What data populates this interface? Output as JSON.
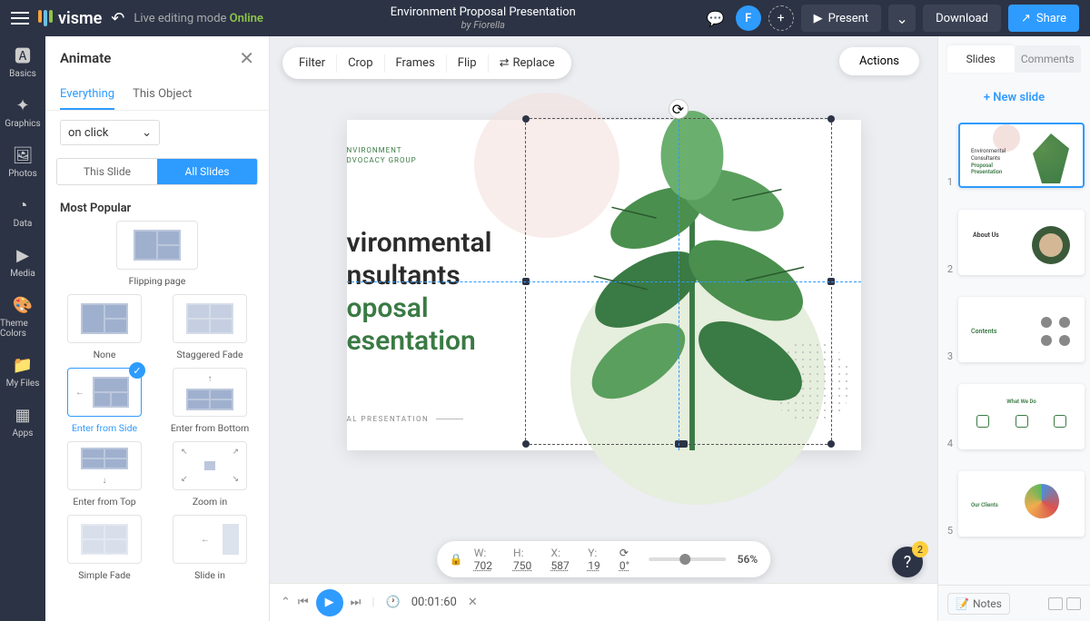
{
  "top": {
    "logo_text": "visme",
    "editing_mode": "Live editing mode",
    "online": "Online",
    "title": "Environment Proposal Presentation",
    "author": "by Fiorella",
    "avatar_initial": "F",
    "present": "Present",
    "download": "Download",
    "share": "Share"
  },
  "iconbar": [
    {
      "label": "Basics"
    },
    {
      "label": "Graphics"
    },
    {
      "label": "Photos"
    },
    {
      "label": "Data"
    },
    {
      "label": "Media"
    },
    {
      "label": "Theme Colors"
    },
    {
      "label": "My Files"
    },
    {
      "label": "Apps"
    }
  ],
  "animate": {
    "title": "Animate",
    "tabs": {
      "everything": "Everything",
      "this_object": "This Object"
    },
    "trigger": "on click",
    "scope": {
      "this_slide": "This Slide",
      "all_slides": "All Slides"
    },
    "section": "Most Popular",
    "items": [
      {
        "label": "Flipping page"
      },
      {
        "label": "None"
      },
      {
        "label": "Staggered Fade"
      },
      {
        "label": "Enter from Side",
        "selected": true
      },
      {
        "label": "Enter from Bottom"
      },
      {
        "label": "Enter from Top"
      },
      {
        "label": "Zoom in"
      },
      {
        "label": "Simple Fade"
      },
      {
        "label": "Slide in"
      }
    ]
  },
  "context_toolbar": {
    "filter": "Filter",
    "crop": "Crop",
    "frames": "Frames",
    "flip": "Flip",
    "replace": "Replace",
    "actions": "Actions"
  },
  "slide": {
    "tag_line1": "NVIRONMENT",
    "tag_line2": "DVOCACY GROUP",
    "headline1": "vironmental",
    "headline2": "nsultants",
    "headline3": "oposal",
    "headline4": "esentation",
    "footer": "AL PRESENTATION"
  },
  "status": {
    "w_label": "W:",
    "w": "702",
    "h_label": "H:",
    "h": "750",
    "x_label": "X:",
    "x": "587",
    "y_label": "Y:",
    "y": "19",
    "angle": "0°",
    "zoom": "56%"
  },
  "bottom": {
    "time": "00:01:60"
  },
  "help": {
    "count": "2"
  },
  "rail": {
    "tab_slides": "Slides",
    "tab_comments": "Comments",
    "new_slide": "New slide",
    "notes": "Notes",
    "thumbs": [
      "1",
      "2",
      "3",
      "4",
      "5"
    ],
    "th1_text_l1": "Environmental",
    "th1_text_l2": "Consultants",
    "th1_text_l3": "Proposal",
    "th1_text_l4": "Presentation",
    "th2_text": "About Us",
    "th3_text": "Contents",
    "th4_title": "What We Do",
    "th5_text": "Our Clients"
  }
}
